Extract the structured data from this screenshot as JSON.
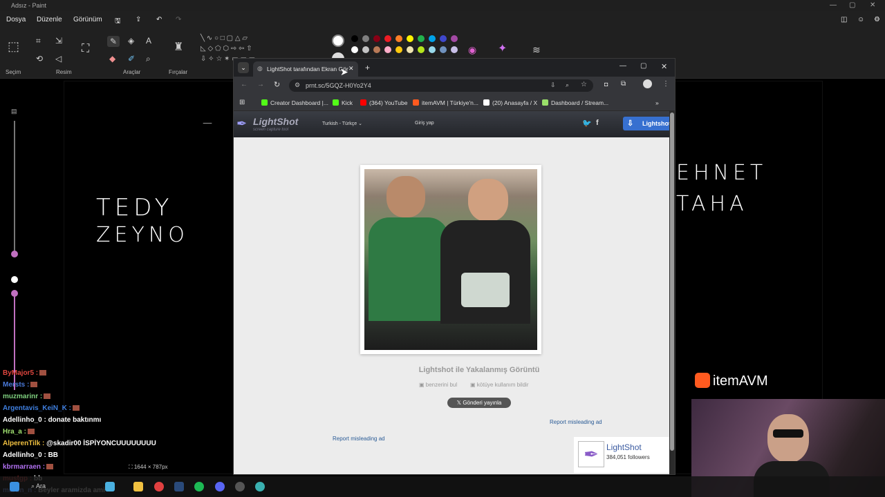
{
  "paint": {
    "title": "Adsız - Paint",
    "menu": [
      "Dosya",
      "Düzenle",
      "Görünüm"
    ],
    "groups": [
      "Seçim",
      "Resim",
      "Araçlar",
      "Fırçalar"
    ],
    "canvas_size": "1644 × 787px",
    "colors": [
      "#000000",
      "#7f7f7f",
      "#880015",
      "#ed1c24",
      "#ff7f27",
      "#fff200",
      "#22b14c",
      "#00a2e8",
      "#3f48cc",
      "#a349a4",
      "#ffffff",
      "#c3c3c3",
      "#b97a57",
      "#ffaec9",
      "#ffc90e",
      "#efe4b0",
      "#b5e61d",
      "#99d9ea",
      "#7092be",
      "#c8bfe7"
    ],
    "handwriting": {
      "left_line1": "TEDY",
      "left_line2": "ZEYNO",
      "right_line1": "EHNET",
      "right_line2": "TAHA"
    }
  },
  "browser": {
    "tab_title": "LightShot tarafından Ekran Gör",
    "url": "prnt.sc/5GQZ-H0Yo2Y4",
    "bookmarks": [
      {
        "label": "Creator Dashboard |...",
        "color": "#53fc18"
      },
      {
        "label": "Kick",
        "color": "#53fc18"
      },
      {
        "label": "(364) YouTube",
        "color": "#ff0000"
      },
      {
        "label": "itemAVM | Türkiye'n...",
        "color": "#ff5a1f"
      },
      {
        "label": "(20) Anasayfa / X",
        "color": "#ffffff"
      },
      {
        "label": "Dashboard / Stream...",
        "color": "#9adf6a"
      }
    ]
  },
  "lightshot": {
    "logo": "LightShot",
    "logo_sub": "screen capture tool",
    "language": "Turkish - Türkçe",
    "login": "Giriş yap",
    "cta": "Lightshot",
    "caption": "Lightshot ile Yakalanmış Görüntü",
    "find_similar": "benzerini bul",
    "report_abuse": "kötüye kullanım bildir",
    "post_button": "Gönderi yayınla",
    "report_ad_1": "Report misleading ad",
    "report_ad_2": "Report misleading ad",
    "widget_name": "LightShot",
    "widget_followers": "384,051 followers"
  },
  "chat": [
    {
      "user": "ByMajor5 :",
      "text": "",
      "color": "#e0463f"
    },
    {
      "user": "Mersts :",
      "text": "",
      "color": "#4a7ad9"
    },
    {
      "user": "muzmarinr :",
      "text": "",
      "color": "#7fd07f"
    },
    {
      "user": "Argentavis_KeiN_K :",
      "text": "",
      "color": "#3f7fdf"
    },
    {
      "user": "Adellinho_0 :",
      "text": "donate baktınmı",
      "color": "#ffffff"
    },
    {
      "user": "Hra_a :",
      "text": "",
      "color": "#a0e070"
    },
    {
      "user": "AlperenTilk :",
      "text": "@skadir00 İSPİYONCUUUUUUUU",
      "color": "#f0c040"
    },
    {
      "user": "Adellinho_0 :",
      "text": "BB",
      "color": "#ffffff"
    },
    {
      "user": "kbrmarraen :",
      "text": "",
      "color": "#b070f0"
    },
    {
      "user": "mustgp :",
      "text": "bb",
      "color": "#e04040"
    },
    {
      "user": "martin_n :",
      "text": "Beyler aramizda ami",
      "color": "#80a0ff"
    }
  ],
  "brand": {
    "overlay": "itemAVM"
  },
  "taskbar": {
    "search": "Ara"
  }
}
